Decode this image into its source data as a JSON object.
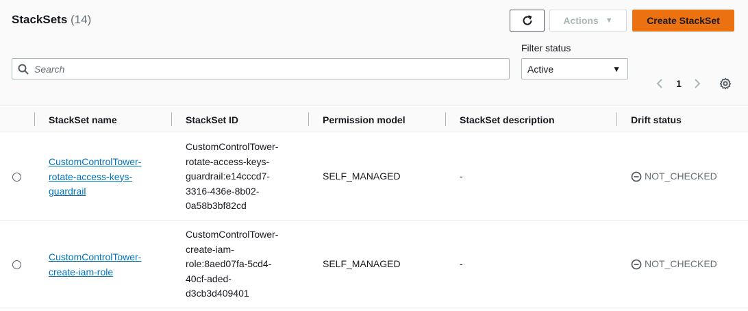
{
  "header": {
    "title": "StackSets",
    "count": "(14)",
    "actions_label": "Actions",
    "create_label": "Create StackSet",
    "refresh_icon": "refresh-icon"
  },
  "search": {
    "placeholder": "Search",
    "value": ""
  },
  "filter": {
    "label": "Filter status",
    "selected": "Active"
  },
  "pagination": {
    "current_page": "1"
  },
  "columns": [
    "StackSet name",
    "StackSet ID",
    "Permission model",
    "StackSet description",
    "Drift status"
  ],
  "rows": [
    {
      "name_lines": [
        "CustomControlTower-",
        "rotate-access-keys-",
        "guardrail"
      ],
      "id_lines": [
        "CustomControlTower-",
        "rotate-access-keys-",
        "guardrail:e14cccd7-",
        "3316-436e-8b02-",
        "0a58b3bf82cd"
      ],
      "permission": "SELF_MANAGED",
      "description": "-",
      "drift": "NOT_CHECKED"
    },
    {
      "name_lines": [
        "CustomControlTower-",
        "create-iam-role"
      ],
      "id_lines": [
        "CustomControlTower-",
        "create-iam-",
        "role:8aed07fa-5cd4-",
        "40cf-aded-",
        "d3cb3d409401"
      ],
      "permission": "SELF_MANAGED",
      "description": "-",
      "drift": "NOT_CHECKED"
    }
  ],
  "colors": {
    "accent": "#ec7211",
    "link": "#0073bb",
    "muted": "#687078"
  }
}
